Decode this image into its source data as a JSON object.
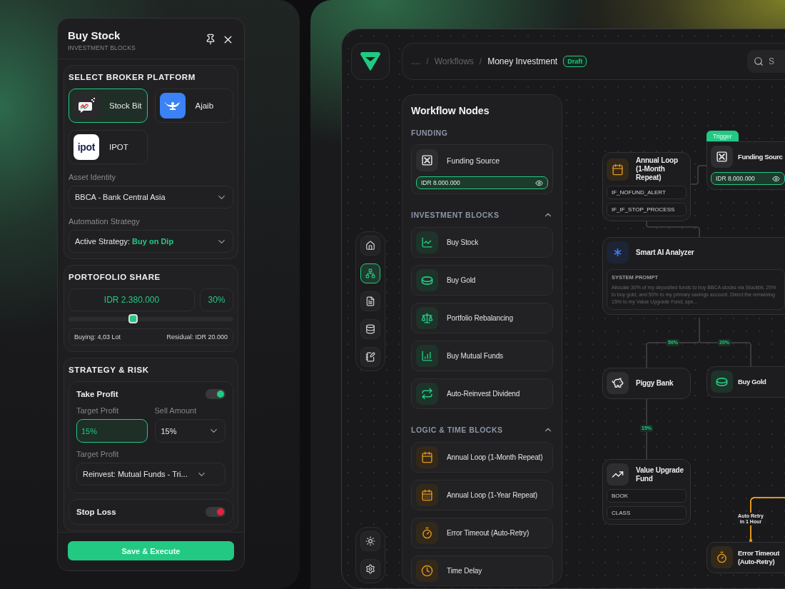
{
  "panel": {
    "title": "Buy Stock",
    "subtitle": "INVESTMENT BLOCKS",
    "brokers_title": "SELECT BROKER PLATFORM",
    "brokers": [
      {
        "name": "Stock Bit",
        "kind": "stockbit",
        "selected": true
      },
      {
        "name": "Ajaib",
        "kind": "ajaib",
        "selected": false
      },
      {
        "name": "IPOT",
        "kind": "ipot",
        "logo_text": "ipot",
        "selected": false
      }
    ],
    "asset": {
      "label": "Asset Identity",
      "value": "BBCA - Bank Central Asia"
    },
    "strategy": {
      "label": "Automation Strategy",
      "value": "Active Strategy: **Buy on Dip**"
    },
    "share": {
      "title": "PORTOFOLIO SHARE",
      "amount": "IDR 2.380.000",
      "percent": "30%",
      "level": 0.39,
      "buying": "Buying: 4,03 Lot",
      "residual": "Residual: IDR 20.000"
    },
    "risk_title": "STRATEGY & RISK",
    "take_profit": {
      "label": "Take Profit",
      "on": true,
      "target_label": "Target Profit",
      "target_value": "15%",
      "sell_label": "Sell Amount",
      "sell_value": "15%",
      "action_label": "Target Profit",
      "action_value": "Reinvest: Mutual Funds - Tri..."
    },
    "stop_loss": {
      "label": "Stop Loss",
      "on": true
    },
    "save_button": "Save & Execute"
  },
  "rail": {
    "top": [
      {
        "selected": false
      },
      {
        "selected": true
      },
      {
        "selected": false
      },
      {
        "selected": false
      },
      {
        "selected": false
      }
    ],
    "bottom": [
      {
        "selected": false
      },
      {
        "selected": false
      }
    ]
  },
  "breadcrumb": {
    "items": [
      "....",
      "Workflows",
      "Money Investment"
    ],
    "separator": "/",
    "badge": "Draft"
  },
  "search": {
    "placeholder": "S"
  },
  "nodes_panel": {
    "title": "Workflow Nodes",
    "sections": [
      {
        "title": "FUNDING",
        "kind": "funding",
        "items": [
          {
            "label": "Funding Source",
            "amount": "IDR 8.000.000"
          }
        ]
      },
      {
        "title": "INVESTMENT BLOCKS",
        "kind": "investment",
        "expanded": true,
        "items": [
          {
            "label": "Buy Stock"
          },
          {
            "label": "Buy Gold"
          },
          {
            "label": "Portfolio Rebalancing"
          },
          {
            "label": "Buy Mutual Funds"
          },
          {
            "label": "Auto-Reinvest Dividend"
          }
        ]
      },
      {
        "title": "LOGIC & TIME BLOCKS",
        "kind": "logic",
        "expanded": true,
        "items": [
          {
            "label": "Annual Loop (1-Month Repeat)"
          },
          {
            "label": "Annual Loop (1-Year Repeat)"
          },
          {
            "label": "Error Timeout (Auto-Retry)"
          },
          {
            "label": "Time Delay"
          }
        ]
      }
    ]
  },
  "canvas": {
    "nodes": [
      {
        "kind": "loop",
        "title": "Annual Loop (1-Month Repeat)",
        "outputs": [
          "IF_NOFUND_ALERT",
          "IF_IF_STOP_PROCESS"
        ]
      },
      {
        "kind": "trigger",
        "badge": "Trigger",
        "title": "Funding Sourc",
        "amount": "IDR 8.000.000"
      },
      {
        "kind": "ai",
        "title": "Smart AI Analyzer",
        "prompt_label": "SYSTEM PROMPT",
        "prompt": "Allocate 30% of my deposited funds to buy BBCA stocks via Stockbit, 20% to buy gold, and 50% to my primary savings account. Direct the remaining 15% to my Value Upgrade Fund, spe..."
      },
      {
        "kind": "piggy",
        "title": "Piggy Bank"
      },
      {
        "kind": "gold",
        "title": "Buy Gold"
      },
      {
        "kind": "fund",
        "title": "Value Upgrade Fund",
        "outputs": [
          "BOOK",
          "CLASS"
        ]
      },
      {
        "kind": "timeout",
        "title": "Error Timeout (Auto-Retry)"
      }
    ],
    "edges": [
      {
        "color": "#3a3a3e"
      },
      {
        "color": "#3a3a3e"
      },
      {
        "color": "#3a3a3e",
        "label": "50%"
      },
      {
        "color": "#3a3a3e",
        "label": "20%"
      },
      {
        "color": "#3a3a3e",
        "label": "15%"
      },
      {
        "color": "#e0961e",
        "label": "Auto Retry in 1 Hour"
      }
    ]
  }
}
